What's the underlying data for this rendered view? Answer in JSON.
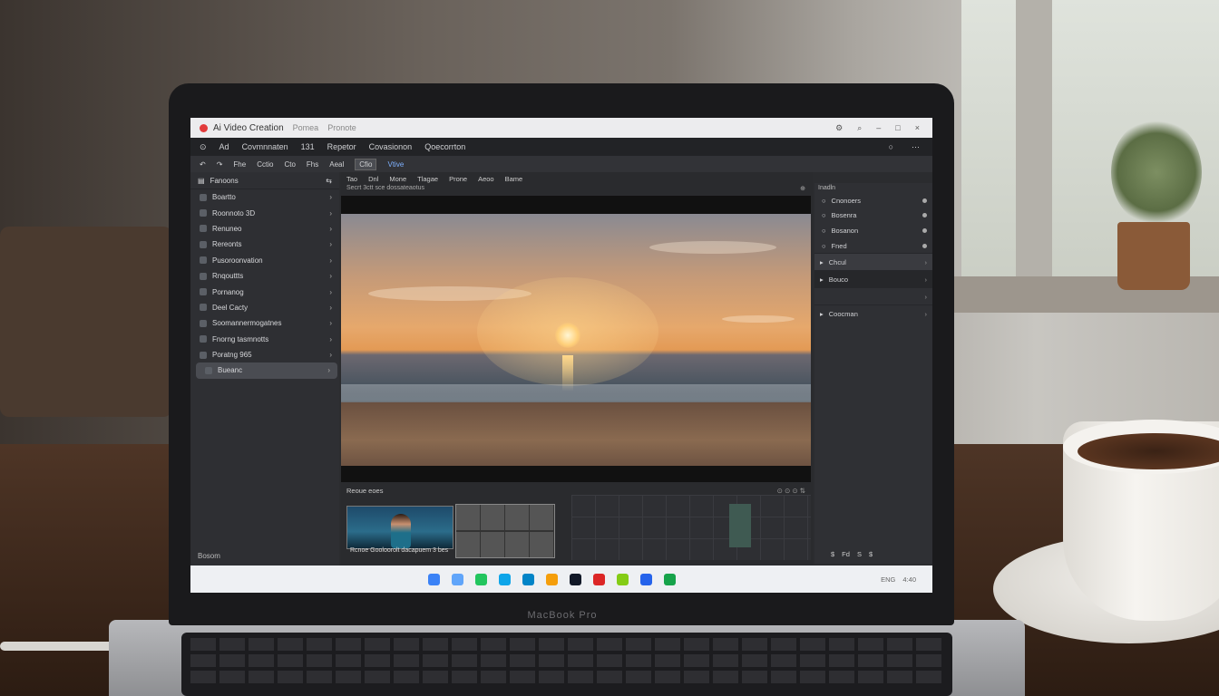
{
  "app": {
    "title": "Ai Video Creation",
    "breadcrumb": "Pomea",
    "breadcrumb2": "Pronote"
  },
  "menubar": {
    "items": [
      "Ad",
      "Covmnnaten",
      "131",
      "Repetor",
      "Covasionon",
      "Qoecorrton"
    ]
  },
  "toolbar": {
    "items": [
      "Fhe",
      "Cctio",
      "Cto",
      "Fhs",
      "Aeal",
      "Cfio",
      "Vtive"
    ],
    "active": "Cfio",
    "link": "Vtive"
  },
  "sidebar": {
    "header": "Fanoons",
    "items": [
      {
        "label": "Boartto",
        "icon": "square-icon"
      },
      {
        "label": "Roonnoto 3D",
        "icon": "globe-icon"
      },
      {
        "label": "Renuneo",
        "icon": "square-icon"
      },
      {
        "label": "Rereonts",
        "icon": "settings-icon"
      },
      {
        "label": "Pusoroonvation",
        "icon": "layers-icon"
      },
      {
        "label": "Rnqouttts",
        "icon": "square-icon"
      },
      {
        "label": "Pornanog",
        "icon": "grid-icon"
      },
      {
        "label": "Deel Cacty",
        "icon": "square-icon"
      },
      {
        "label": "Soomannermogatnes",
        "icon": "circle-icon"
      },
      {
        "label": "Fnorng tasmnotts",
        "icon": "square-icon"
      },
      {
        "label": "Poratng 965",
        "icon": "link-icon"
      },
      {
        "label": "Bueanc",
        "icon": "circle-icon"
      }
    ],
    "footer": "Bosom"
  },
  "center": {
    "tabs": [
      "Tao",
      "Dnl",
      "Mone",
      "Tlagae",
      "Prone",
      "Aeoo",
      "Bame"
    ],
    "info": "Secrt 3ctt sce dossateaotus",
    "timeline_label": "Reoue eoes",
    "clip_label": "Rcnoe Gooloorolt dacapuem 3 bes"
  },
  "rightpanel": {
    "title": "Inadln",
    "items": [
      "Cnonoers",
      "Bosenra",
      "Bosanon",
      "Fned"
    ],
    "sections": [
      {
        "label": "Chcul",
        "style": "hl"
      },
      {
        "label": "Bouco",
        "style": "dark"
      },
      {
        "label": "",
        "style": ""
      },
      {
        "label": "Coocman",
        "style": ""
      }
    ],
    "footer": [
      "$",
      "Fd",
      "S",
      "$"
    ]
  },
  "taskbar": {
    "apps": [
      {
        "name": "files-icon",
        "color": "#3b82f6"
      },
      {
        "name": "store-icon",
        "color": "#60a5fa"
      },
      {
        "name": "browser-icon",
        "color": "#22c55e"
      },
      {
        "name": "mail-icon",
        "color": "#0ea5e9"
      },
      {
        "name": "edge-icon",
        "color": "#0284c7"
      },
      {
        "name": "photos-icon",
        "color": "#f59e0b"
      },
      {
        "name": "camera-icon",
        "color": "#111827"
      },
      {
        "name": "video-icon",
        "color": "#dc2626"
      },
      {
        "name": "music-icon",
        "color": "#84cc16"
      },
      {
        "name": "chrome-icon",
        "color": "#2563eb"
      },
      {
        "name": "sheets-icon",
        "color": "#16a34a"
      }
    ],
    "tray": [
      "ENG",
      "4:40"
    ]
  },
  "laptop": {
    "brand": "MacBook Pro"
  }
}
